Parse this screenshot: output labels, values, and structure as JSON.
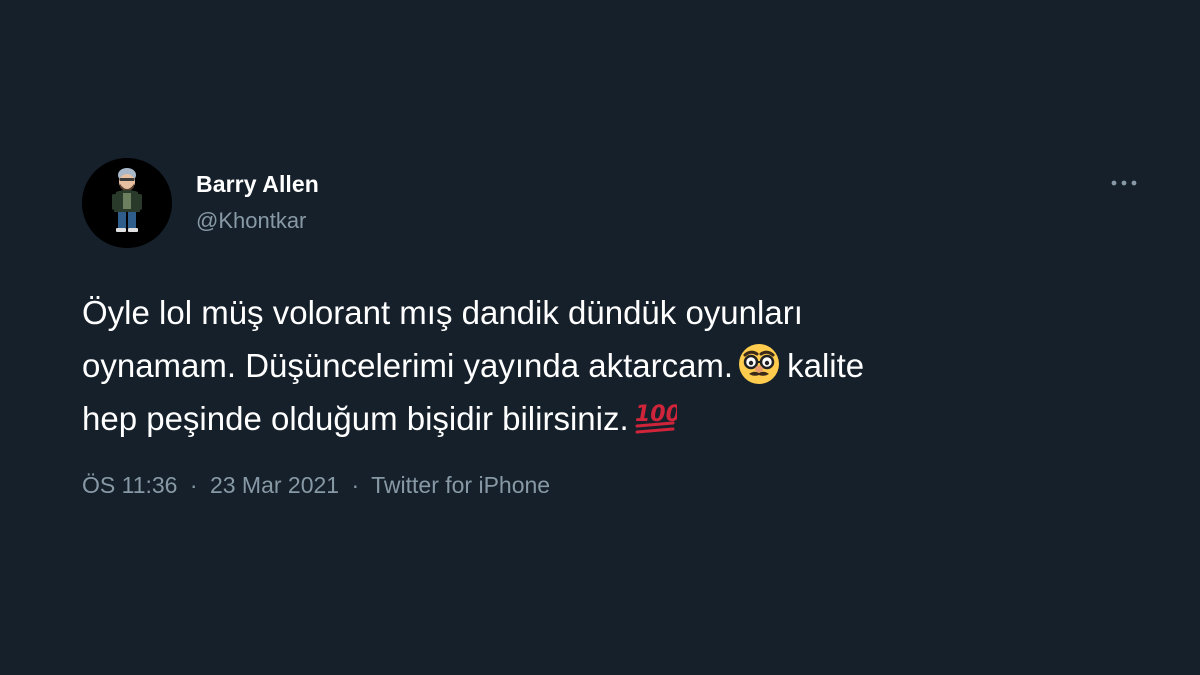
{
  "tweet": {
    "author": {
      "display_name": "Barry Allen",
      "handle": "@Khontkar",
      "avatar_icon": "cartoon-person-avatar"
    },
    "more_icon": "more-options-icon",
    "text": {
      "line1": "Öyle lol müş volorant mış dandik dündük oyunları",
      "line2_before_emoji": "oynamam. Düşüncelerimi yayında aktarcam.",
      "emoji1": "disguised-face-emoji",
      "line2_after_emoji": "kalite",
      "line3": "hep peşinde olduğum bişidir bilirsiniz.",
      "emoji2": "hundred-points-emoji"
    },
    "meta": {
      "time": "ÖS 11:36",
      "separator": "·",
      "date": "23 Mar 2021",
      "source": "Twitter for iPhone"
    }
  },
  "colors": {
    "background": "#15202b",
    "primary_text": "#ffffff",
    "secondary_text": "#8899a6"
  }
}
